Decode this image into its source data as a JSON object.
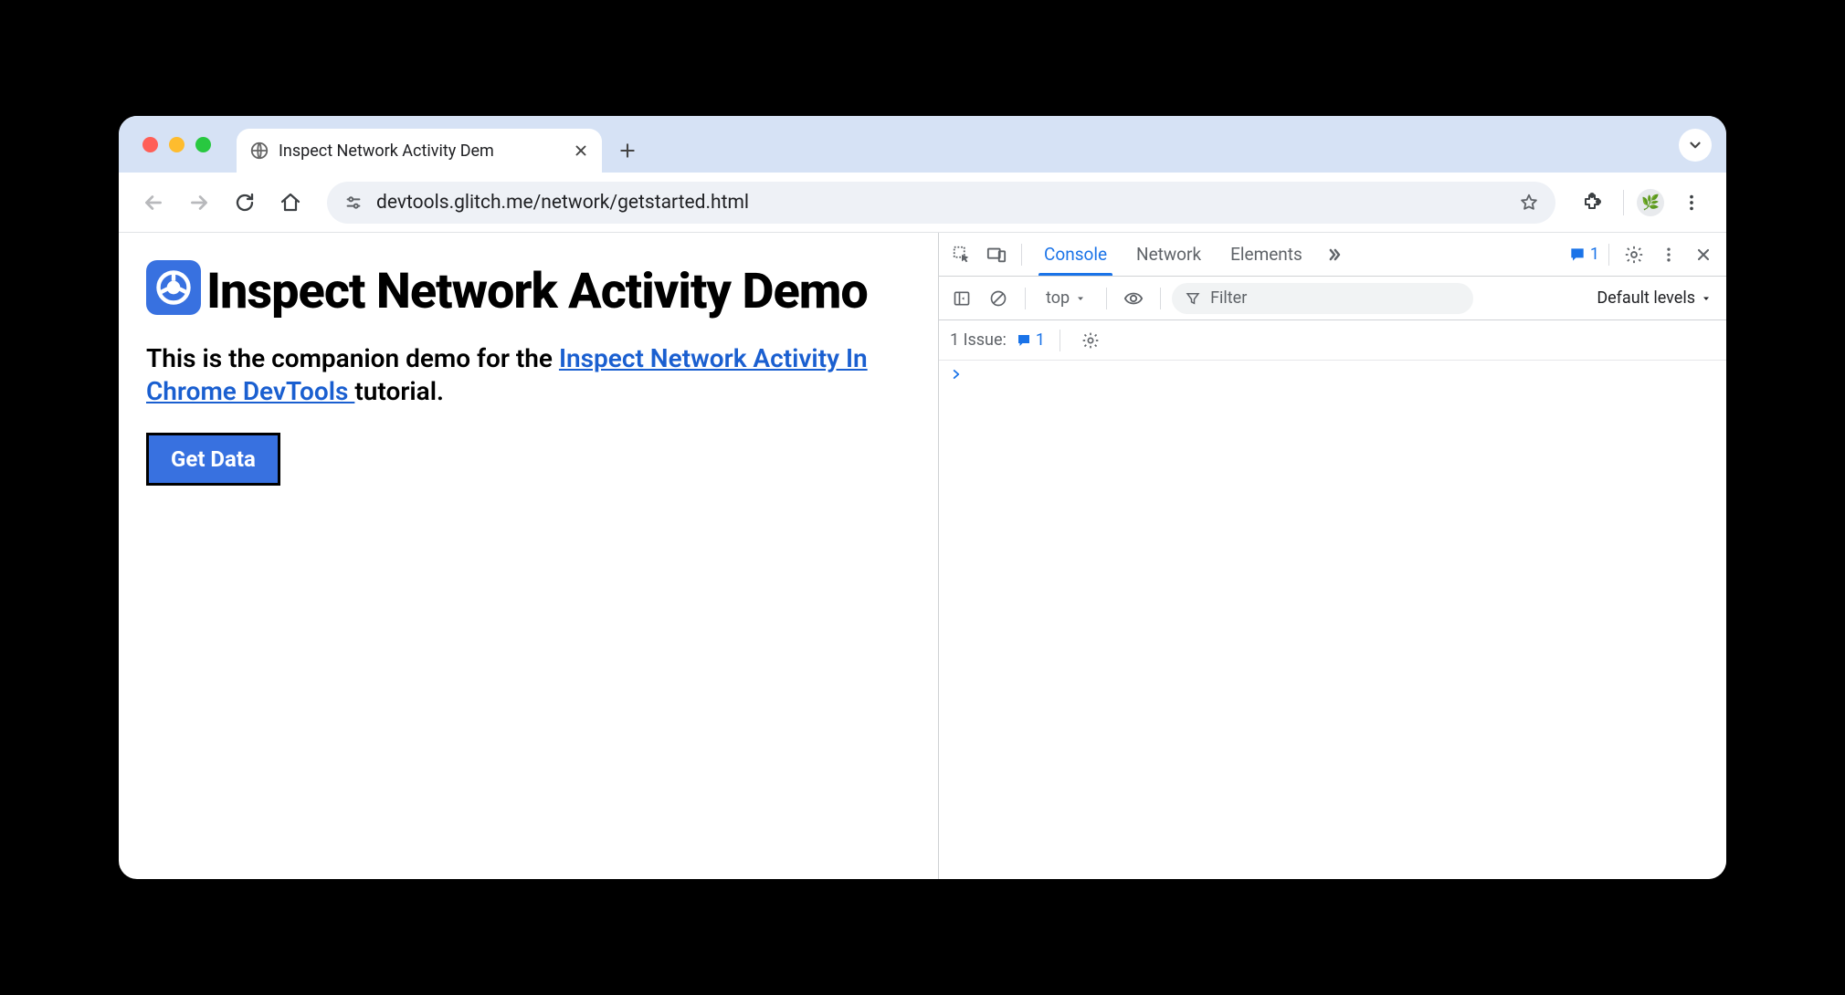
{
  "tab": {
    "title": "Inspect Network Activity Dem"
  },
  "omnibox": {
    "url": "devtools.glitch.me/network/getstarted.html"
  },
  "page": {
    "heading": "Inspect Network Activity Demo",
    "intro_pre": "This is the companion demo for the ",
    "intro_link": "Inspect Network Activity In Chrome DevTools ",
    "intro_post": "tutorial.",
    "button": "Get Data"
  },
  "devtools": {
    "tabs": {
      "console": "Console",
      "network": "Network",
      "elements": "Elements"
    },
    "issues_count": "1",
    "console": {
      "context": "top",
      "filter_placeholder": "Filter",
      "levels_label": "Default levels",
      "issue_label": "1 Issue:",
      "issue_count": "1"
    }
  }
}
